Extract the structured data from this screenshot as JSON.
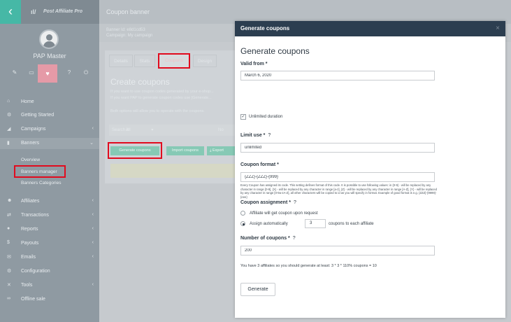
{
  "sidebar": {
    "back_icon": "chevron-left-icon",
    "brand_mark": "ıl/",
    "brand": "Post Affiliate Pro",
    "user_name": "PAP Master",
    "quick_icons": [
      "pencil-icon",
      "monitor-icon",
      "heart-icon",
      "help-icon",
      "power-icon"
    ],
    "quick_glyphs": [
      "✎",
      "▭",
      "♥",
      "?",
      "⏻"
    ],
    "items": [
      {
        "label": "Home",
        "icon": "home-icon",
        "glyph": "⌂",
        "chevron": ""
      },
      {
        "label": "Getting Started",
        "icon": "gear-icon",
        "glyph": "⚙",
        "chevron": ""
      },
      {
        "label": "Campaigns",
        "icon": "megaphone-icon",
        "glyph": "◢",
        "chevron": "‹"
      },
      {
        "label": "Banners",
        "icon": "banner-icon",
        "glyph": "▮",
        "chevron": "⌄"
      },
      {
        "label": "Affiliates",
        "icon": "affiliates-icon",
        "glyph": "☻",
        "chevron": "‹"
      },
      {
        "label": "Transactions",
        "icon": "transactions-icon",
        "glyph": "⇄",
        "chevron": "‹"
      },
      {
        "label": "Reports",
        "icon": "reports-icon",
        "glyph": "●",
        "chevron": "‹"
      },
      {
        "label": "Payouts",
        "icon": "dollar-icon",
        "glyph": "$",
        "chevron": "‹"
      },
      {
        "label": "Emails",
        "icon": "email-icon",
        "glyph": "✉",
        "chevron": "‹"
      },
      {
        "label": "Configuration",
        "icon": "gear-icon",
        "glyph": "⚙",
        "chevron": ""
      },
      {
        "label": "Tools",
        "icon": "tools-icon",
        "glyph": "✕",
        "chevron": "‹"
      },
      {
        "label": "Offline sale",
        "icon": "offline-sale-icon",
        "glyph": "∞",
        "chevron": ""
      }
    ],
    "banner_sub": [
      "Overview",
      "Banners manager",
      "Banners Categories"
    ]
  },
  "main": {
    "title": "Coupon banner",
    "banner_id": "Banner Id: e8d1cd53",
    "campaign": "Campaign: My campaign",
    "tabs": [
      "Details",
      "Stats",
      "Coupons",
      "Design"
    ],
    "create_title": "Create coupons",
    "desc1": "If you want to use coupon codes generated by your e-shop...",
    "desc2": "If you want PAP to generate coupon codes use [Generate...",
    "desc3": "Both options will allow you to operate with the coupons.",
    "search_label": "Search in",
    "search_value": "All",
    "search_no": "No",
    "generate_coupons_btn": "Generate coupons",
    "import_coupons_btn": "Import coupons",
    "export_btn": "Export"
  },
  "modal": {
    "header": "Generate coupons",
    "close": "×",
    "title": "Generate coupons",
    "valid_from_label": "Valid from *",
    "valid_from_value": "March 6, 2020",
    "unlimited_duration_label": "Unlimited duration",
    "limit_use_label": "Limit use *",
    "limit_use_value": "unlimited",
    "coupon_format_label": "Coupon format *",
    "coupon_format_value": "{ZZZ}-{ZZZ}-{999}",
    "coupon_format_help": "Every Coupon has assigned its code. This setting defines format of this code. It is possible to use following values: in {0-9} - will be replaced by any character in range [0-9], {X} - will be replaced by any character in range [a-z], {Z} - will be replaced by any character in range [A-Z], {Y} - will be replaced by any character in range [0-9a-zA-Z], all other characters will be copied to id as you will specify in format. Example of good format is e.g. {ZZZ}-{9999}-{eee}",
    "coupon_assignment_label": "Coupon assignment *",
    "option_request": "Affiliate will get coupon upon request",
    "option_auto": "Assign automatically",
    "assign_count": "3",
    "assign_suffix": "coupons to each affiliate",
    "number_label": "Number of coupons *",
    "number_value": "200",
    "info": "You have 3 affiliates so you should generate at least: 3 * 3 * 110% coupons = 10",
    "generate_btn": "Generate",
    "help_mark": "?"
  }
}
